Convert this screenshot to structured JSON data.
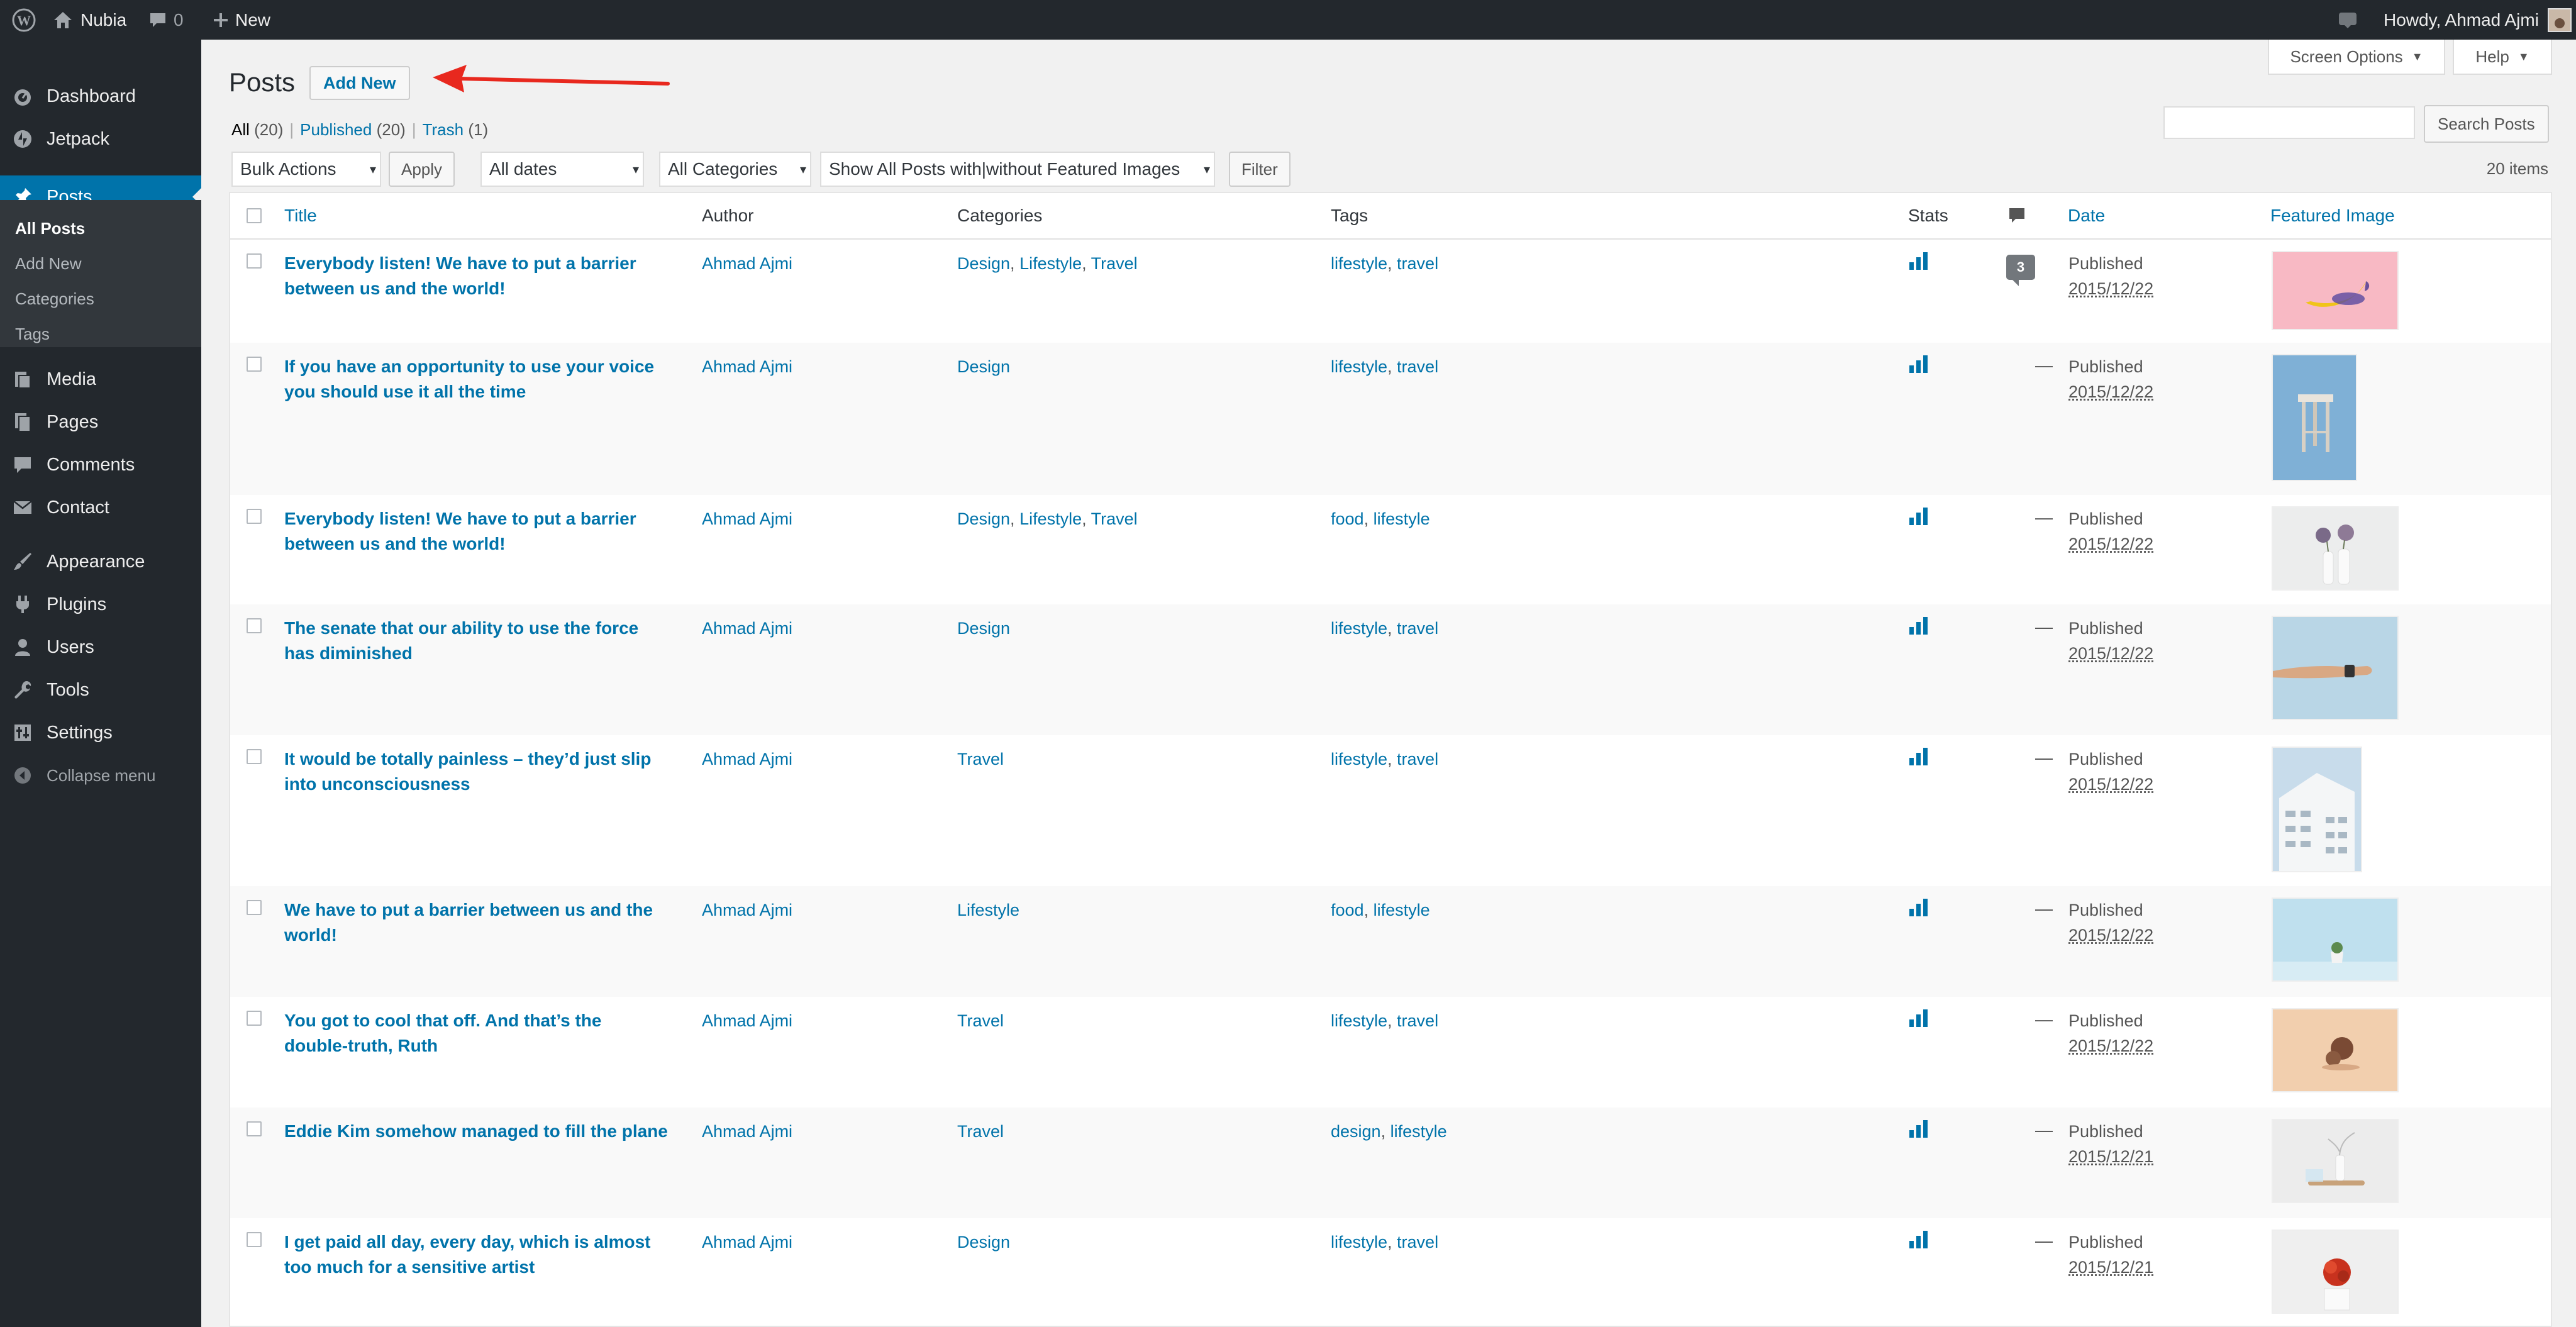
{
  "admin_bar": {
    "site_name": "Nubia",
    "comments_count": "0",
    "new_label": "New",
    "howdy": "Howdy, Ahmad Ajmi"
  },
  "sidebar": {
    "items": [
      {
        "label": "Dashboard",
        "icon": "dashboard-icon"
      },
      {
        "label": "Jetpack",
        "icon": "jetpack-icon"
      },
      {
        "label": "Posts",
        "icon": "pin-icon"
      },
      {
        "label": "Media",
        "icon": "media-icon"
      },
      {
        "label": "Pages",
        "icon": "pages-icon"
      },
      {
        "label": "Comments",
        "icon": "comments-icon"
      },
      {
        "label": "Contact",
        "icon": "mail-icon"
      },
      {
        "label": "Appearance",
        "icon": "brush-icon"
      },
      {
        "label": "Plugins",
        "icon": "plug-icon"
      },
      {
        "label": "Users",
        "icon": "user-icon"
      },
      {
        "label": "Tools",
        "icon": "wrench-icon"
      },
      {
        "label": "Settings",
        "icon": "settings-icon"
      }
    ],
    "submenu": [
      "All Posts",
      "Add New",
      "Categories",
      "Tags"
    ],
    "collapse": "Collapse menu"
  },
  "header": {
    "screen_options": "Screen Options",
    "help": "Help",
    "title": "Posts",
    "add_new": "Add New"
  },
  "views": {
    "all": "All",
    "all_count": "(20)",
    "published": "Published",
    "published_count": "(20)",
    "trash": "Trash",
    "trash_count": "(1)"
  },
  "search": {
    "button": "Search Posts",
    "value": ""
  },
  "filters": {
    "bulk_actions": "Bulk Actions",
    "apply": "Apply",
    "dates": "All dates",
    "categories": "All Categories",
    "featured": "Show All Posts with|without Featured Images",
    "filter": "Filter",
    "items_count": "20 items"
  },
  "columns": {
    "title": "Title",
    "author": "Author",
    "categories": "Categories",
    "tags": "Tags",
    "stats": "Stats",
    "date": "Date",
    "featured_image": "Featured Image"
  },
  "posts": [
    {
      "title": [
        "Everybody listen! We have to put a barrier",
        "between us and the world!"
      ],
      "author": "Ahmad Ajmi",
      "cats": [
        "Design",
        "Lifestyle",
        "Travel"
      ],
      "tags": [
        "lifestyle",
        "travel"
      ],
      "comments": "3",
      "status": "Published",
      "date": "2015/12/22"
    },
    {
      "title": [
        "If you have an opportunity to use your voice",
        "you should use it all the time"
      ],
      "author": "Ahmad Ajmi",
      "cats": [
        "Design"
      ],
      "tags": [
        "lifestyle",
        "travel"
      ],
      "comments": "—",
      "status": "Published",
      "date": "2015/12/22"
    },
    {
      "title": [
        "Everybody listen! We have to put a barrier",
        "between us and the world!"
      ],
      "author": "Ahmad Ajmi",
      "cats": [
        "Design",
        "Lifestyle",
        "Travel"
      ],
      "tags": [
        "food",
        "lifestyle"
      ],
      "comments": "—",
      "status": "Published",
      "date": "2015/12/22"
    },
    {
      "title": [
        "The senate that our ability to use the force",
        "has diminished"
      ],
      "author": "Ahmad Ajmi",
      "cats": [
        "Design"
      ],
      "tags": [
        "lifestyle",
        "travel"
      ],
      "comments": "—",
      "status": "Published",
      "date": "2015/12/22"
    },
    {
      "title": [
        "It would be totally painless – they’d just slip",
        "into unconsciousness"
      ],
      "author": "Ahmad Ajmi",
      "cats": [
        "Travel"
      ],
      "tags": [
        "lifestyle",
        "travel"
      ],
      "comments": "—",
      "status": "Published",
      "date": "2015/12/22"
    },
    {
      "title": [
        "We have to put a barrier between us and the",
        "world!"
      ],
      "author": "Ahmad Ajmi",
      "cats": [
        "Lifestyle"
      ],
      "tags": [
        "food",
        "lifestyle"
      ],
      "comments": "—",
      "status": "Published",
      "date": "2015/12/22"
    },
    {
      "title": [
        "You got to cool that off. And that’s the",
        "double-truth, Ruth"
      ],
      "author": "Ahmad Ajmi",
      "cats": [
        "Travel"
      ],
      "tags": [
        "lifestyle",
        "travel"
      ],
      "comments": "—",
      "status": "Published",
      "date": "2015/12/22"
    },
    {
      "title": [
        "Eddie Kim somehow managed to fill the plane",
        ""
      ],
      "author": "Ahmad Ajmi",
      "cats": [
        "Travel"
      ],
      "tags": [
        "design",
        "lifestyle"
      ],
      "comments": "—",
      "status": "Published",
      "date": "2015/12/21"
    },
    {
      "title": [
        "I get paid all day, every day, which is almost",
        "too much for a sensitive artist"
      ],
      "author": "Ahmad Ajmi",
      "cats": [
        "Design"
      ],
      "tags": [
        "lifestyle",
        "travel"
      ],
      "comments": "—",
      "status": "Published",
      "date": "2015/12/21"
    }
  ],
  "colors": {
    "accent": "#0073aa",
    "sidebar_bg": "#23282d",
    "arrow": "#e8281e"
  }
}
